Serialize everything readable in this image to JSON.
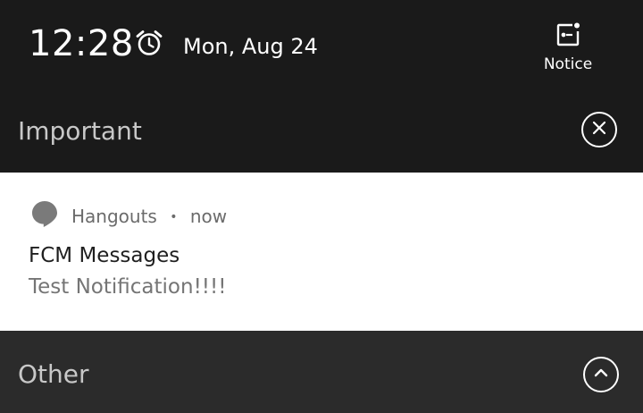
{
  "status": {
    "time": "12:28",
    "date": "Mon, Aug 24",
    "alarm_icon": "alarm-clock-icon"
  },
  "notice": {
    "label": "Notice",
    "icon": "notice-icon"
  },
  "sections": {
    "important": {
      "title": "Important",
      "action_icon": "close-icon"
    },
    "other": {
      "title": "Other",
      "action_icon": "chevron-up-icon"
    }
  },
  "notification": {
    "app_name": "Hangouts",
    "separator": "•",
    "time": "now",
    "title": "FCM Messages",
    "text": "Test Notification!!!!",
    "app_icon": "hangouts-icon"
  },
  "colors": {
    "background": "#1a1a1a",
    "card": "#ffffff",
    "other_section": "#2b2b2b",
    "section_title": "#c8c8c8",
    "app_meta": "#6b6b6b",
    "hangouts_icon": "#7a7a7a"
  }
}
